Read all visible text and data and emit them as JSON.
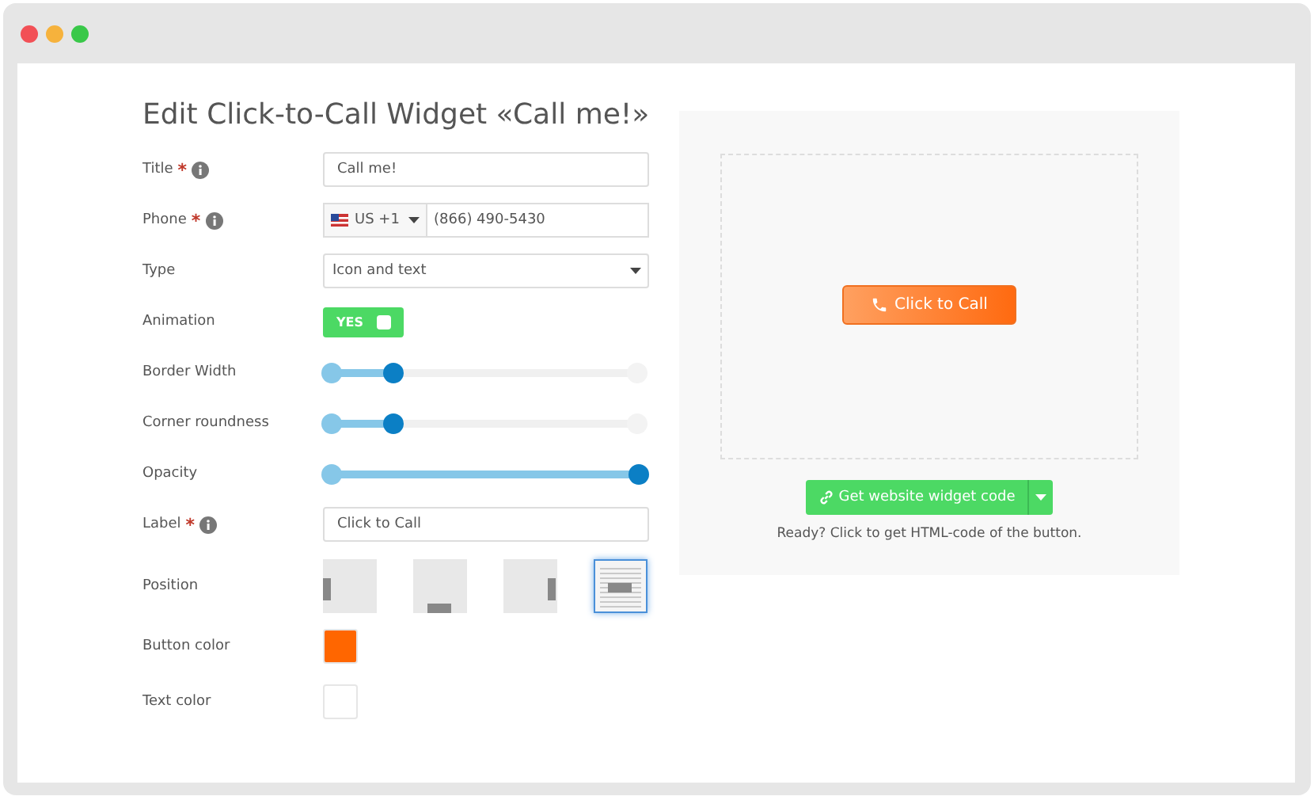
{
  "heading": "Edit Click-to-Call Widget «Call me!»",
  "fields": [
    {
      "kind": "text",
      "label": "Title",
      "required_mark": "*",
      "info": true,
      "value": "Call me!"
    },
    {
      "kind": "phone",
      "label": "Phone",
      "required_mark": "*",
      "info": true,
      "country": "US +1",
      "value": "(866) 490-5430"
    },
    {
      "kind": "select",
      "label": "Type",
      "value": "Icon and text"
    },
    {
      "kind": "toggle",
      "label": "Animation",
      "on": true,
      "text": "YES"
    },
    {
      "kind": "slider",
      "label": "Border Width",
      "level": 0.2
    },
    {
      "kind": "slider",
      "label": "Corner roundness",
      "level": 0.2
    },
    {
      "kind": "slider",
      "label": "Opacity",
      "level": 1
    },
    {
      "kind": "text",
      "label": "Label",
      "required_mark": "*",
      "info": true,
      "value": "Click to Call"
    },
    {
      "kind": "position",
      "label": "Position",
      "options": [
        {
          "kind": "left",
          "selected": false
        },
        {
          "kind": "bottom",
          "selected": false
        },
        {
          "kind": "right",
          "selected": false
        },
        {
          "kind": "center",
          "selected": true
        }
      ]
    },
    {
      "kind": "color",
      "label": "Button color",
      "color": "#ff6600"
    },
    {
      "kind": "color",
      "label": "Text color",
      "color": "#ffffff"
    }
  ],
  "preview": {
    "button": "Click to Call",
    "code_button": "Get website widget code",
    "hint": "Ready? Click to get HTML-code of the button."
  }
}
